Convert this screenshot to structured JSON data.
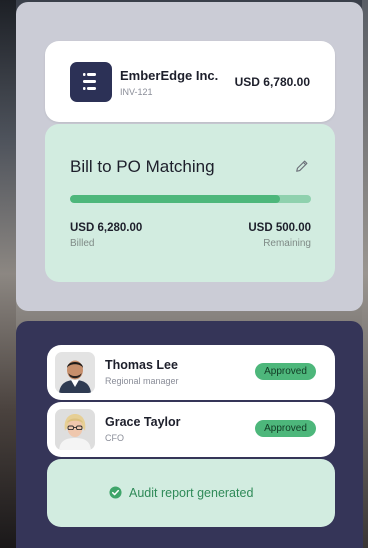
{
  "invoice": {
    "company": "EmberEdge Inc.",
    "id": "INV-121",
    "amount": "USD 6,780.00"
  },
  "matching": {
    "title": "Bill to PO Matching",
    "progress_fraction": 0.87,
    "billed_value": "USD 6,280.00",
    "billed_label": "Billed",
    "remaining_value": "USD 500.00",
    "remaining_label": "Remaining"
  },
  "approvers": [
    {
      "name": "Thomas Lee",
      "role": "Regional manager",
      "status": "Approved"
    },
    {
      "name": "Grace Taylor",
      "role": "CFO",
      "status": "Approved"
    }
  ],
  "audit": {
    "text": "Audit report generated"
  },
  "colors": {
    "accent_green": "#4db77b",
    "card_mint": "#d2ece0",
    "panel_lavender": "#cbccd6",
    "panel_navy": "#353558",
    "logo_navy": "#2c3156"
  },
  "icons": [
    "logo-icon",
    "pencil-icon",
    "check-circle-icon"
  ]
}
